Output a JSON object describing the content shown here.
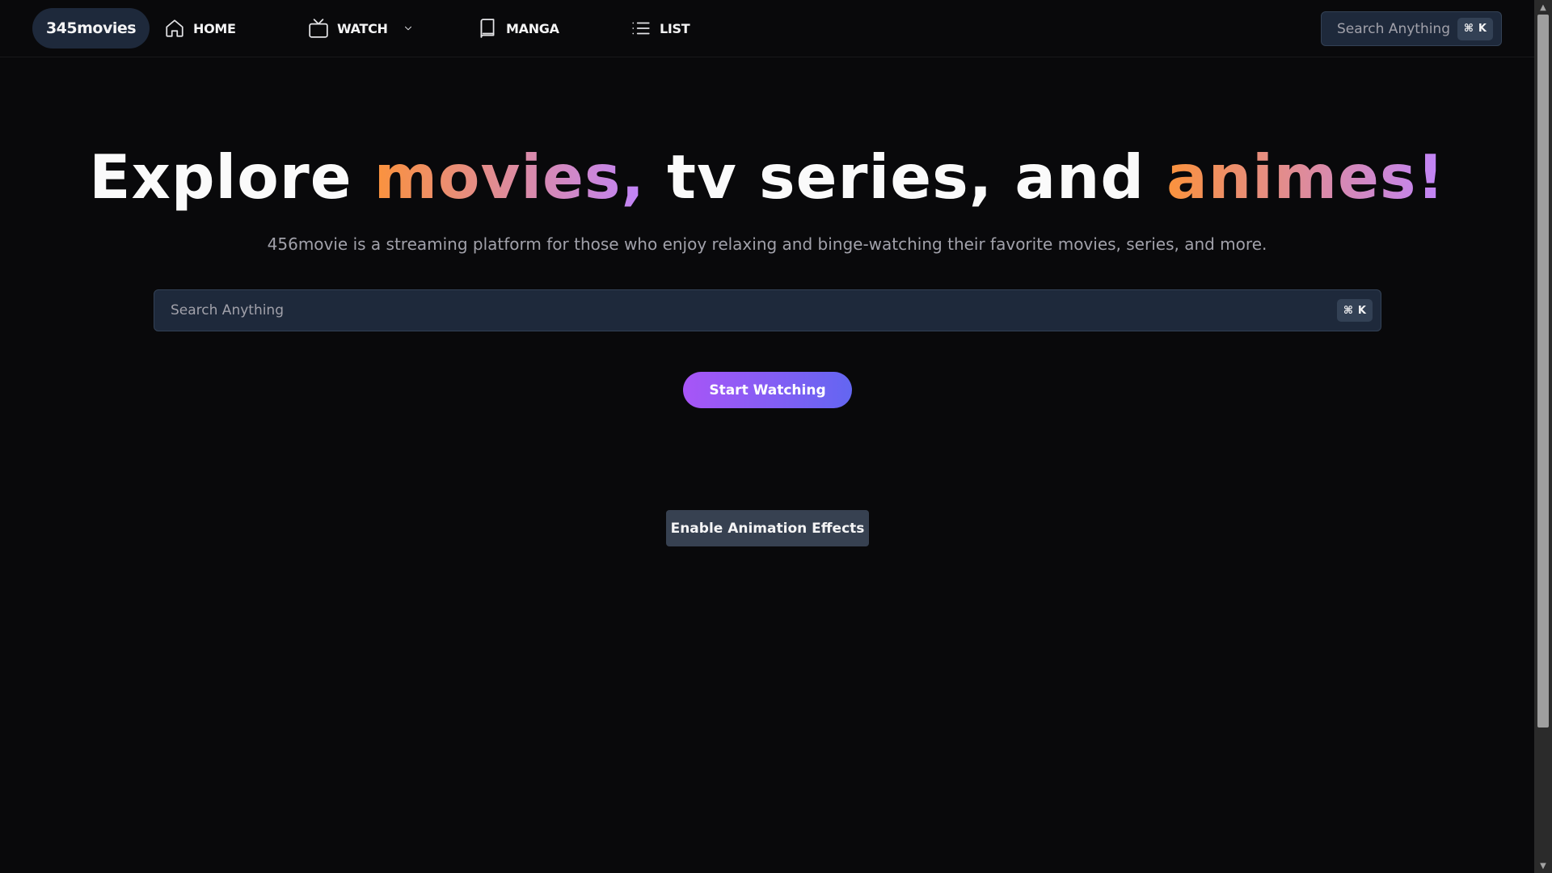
{
  "nav": {
    "logo": "345movies",
    "items": [
      {
        "label": "HOME",
        "icon": "home-icon"
      },
      {
        "label": "WATCH",
        "icon": "tv-icon",
        "has_dropdown": true
      },
      {
        "label": "MANGA",
        "icon": "book-icon"
      },
      {
        "label": "LIST",
        "icon": "list-icon"
      }
    ],
    "search": {
      "placeholder": "Search Anything",
      "shortcut_symbol": "⌘",
      "shortcut_key": "K"
    }
  },
  "hero": {
    "title_parts": [
      "Explore",
      "movies,",
      "tv series, and",
      "animes!"
    ],
    "subtitle": "456movie is a streaming platform for those who enjoy relaxing and binge-watching their favorite movies, series, and more.",
    "search": {
      "placeholder": "Search Anything",
      "shortcut_symbol": "⌘",
      "shortcut_key": "K"
    },
    "cta_label": "Start Watching",
    "animation_toggle_label": "Enable Animation Effects"
  },
  "colors": {
    "background": "#09090b",
    "gradient_start": "#fb923c",
    "gradient_end": "#c084fc",
    "button_gradient_start": "#a855f7",
    "button_gradient_end": "#6366f1"
  },
  "scrollbar": {
    "up_arrow": "▲",
    "down_arrow": "▼"
  }
}
